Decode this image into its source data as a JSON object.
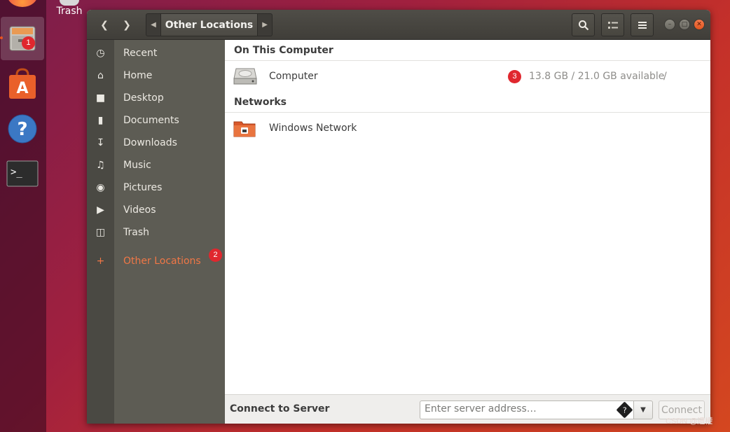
{
  "desktop": {
    "trash_label": "Trash"
  },
  "dock": {
    "items": [
      {
        "name": "Files"
      },
      {
        "name": "Ubuntu Software"
      },
      {
        "name": "Help"
      },
      {
        "name": "Terminal"
      }
    ],
    "badge_1": "1"
  },
  "header": {
    "path_current": "Other Locations"
  },
  "sidebar": {
    "items": [
      {
        "label": "Recent",
        "icon": "clock-icon"
      },
      {
        "label": "Home",
        "icon": "home-icon"
      },
      {
        "label": "Desktop",
        "icon": "folder-icon"
      },
      {
        "label": "Documents",
        "icon": "document-icon"
      },
      {
        "label": "Downloads",
        "icon": "download-icon"
      },
      {
        "label": "Music",
        "icon": "music-icon"
      },
      {
        "label": "Pictures",
        "icon": "camera-icon"
      },
      {
        "label": "Videos",
        "icon": "video-icon"
      },
      {
        "label": "Trash",
        "icon": "trash-icon"
      }
    ],
    "other_locations": "Other Locations",
    "badge_2": "2"
  },
  "content": {
    "on_this_computer": "On This Computer",
    "computer_label": "Computer",
    "computer_info": "13.8 GB / 21.0 GB available",
    "computer_path": "/",
    "badge_3": "3",
    "networks": "Networks",
    "windows_network_label": "Windows Network"
  },
  "bottombar": {
    "connect_label": "Connect to Server",
    "server_placeholder": "Enter server address…",
    "connect_button": "Connect"
  },
  "watermark": "CSDN @遗權"
}
